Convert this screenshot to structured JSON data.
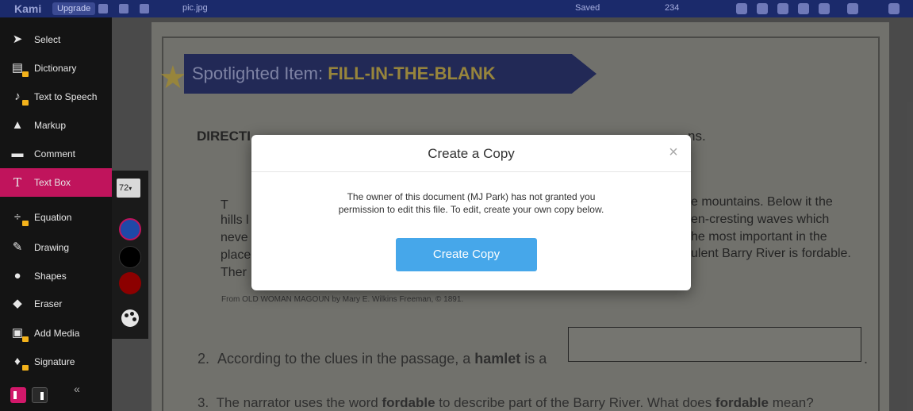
{
  "app": {
    "logo": "Kami",
    "upgrade_label": "Upgrade",
    "filename": "pic.jpg",
    "save_status": "Saved",
    "zoom": "234"
  },
  "toolbar": {
    "items": [
      {
        "label": "Select",
        "icon": "cursor-icon"
      },
      {
        "label": "Dictionary",
        "icon": "book-icon"
      },
      {
        "label": "Text to Speech",
        "icon": "speaker-icon"
      },
      {
        "label": "Markup",
        "icon": "highlighter-icon"
      },
      {
        "label": "Comment",
        "icon": "comment-icon"
      },
      {
        "label": "Text Box",
        "icon": "text-icon"
      },
      {
        "label": "Equation",
        "icon": "divide-icon"
      },
      {
        "label": "Drawing",
        "icon": "pen-icon"
      },
      {
        "label": "Shapes",
        "icon": "shapes-icon"
      },
      {
        "label": "Eraser",
        "icon": "eraser-icon"
      },
      {
        "label": "Add Media",
        "icon": "media-icon"
      },
      {
        "label": "Signature",
        "icon": "signature-icon"
      }
    ],
    "active": "Text Box",
    "collapse_glyph": "«"
  },
  "textbox_palette": {
    "font_size": "72",
    "colors": [
      "#1f49a8",
      "#000000",
      "#8c0000"
    ],
    "selected_color": "#1f49a8"
  },
  "document": {
    "banner_prefix": "Spotlighted Item: ",
    "banner_highlight": "FILL-IN-THE-BLANK",
    "directions_visible": "DIRECTI",
    "directions_tail": "ns.",
    "passage_left": [
      "T",
      "hills l",
      "neve",
      "place",
      "Ther"
    ],
    "passage_right": [
      "e mountains. Below it the",
      "en-cresting waves which",
      "he most important in the",
      "ulent Barry River is fordable."
    ],
    "source": "From OLD WOMAN MAGOUN by Mary E. Wilkins Freeman, © 1891.",
    "q2_number": "2.",
    "q2_prefix": "According to the clues in the passage, a ",
    "q2_bold": "hamlet",
    "q2_suffix": " is a",
    "q2_end": ".",
    "q3_number": "3.",
    "q3_prefix": "The narrator uses the word ",
    "q3_bold1": "fordable",
    "q3_middle": " to describe part of the Barry River. What does ",
    "q3_bold2": "fordable",
    "q3_suffix": " mean?"
  },
  "modal": {
    "title": "Create a Copy",
    "close_glyph": "×",
    "message_line1": "The owner of this document (MJ Park) has not granted you",
    "message_line2": "permission to edit this file. To edit, create your own copy below.",
    "button_label": "Create Copy"
  }
}
